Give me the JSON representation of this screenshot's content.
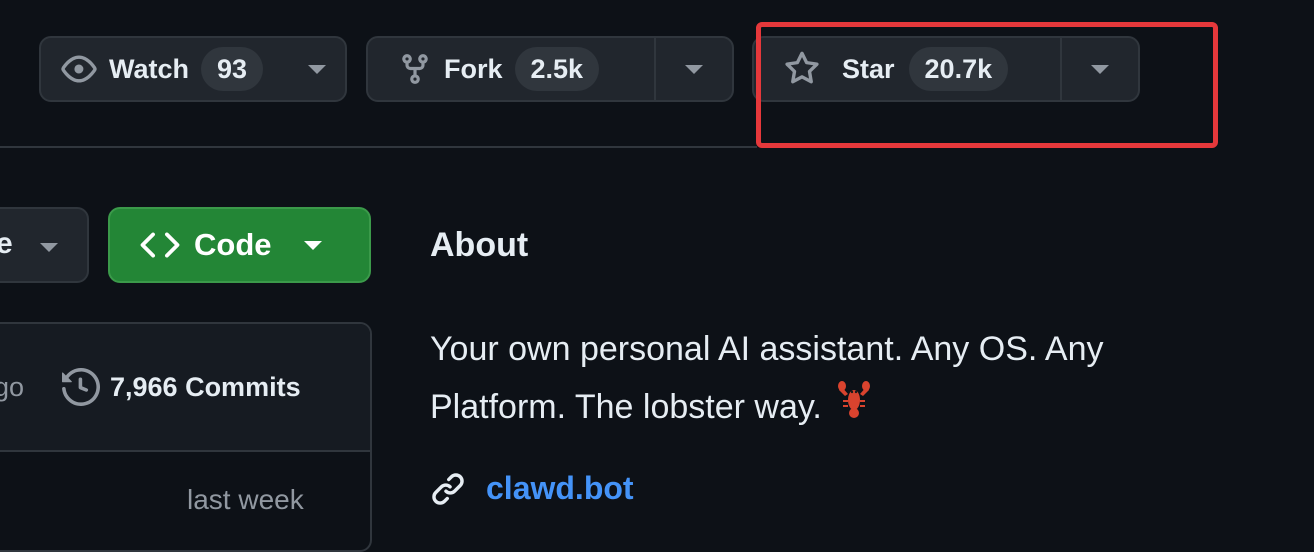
{
  "header": {
    "watch": {
      "label": "Watch",
      "count": "93"
    },
    "fork": {
      "label": "Fork",
      "count": "2.5k"
    },
    "star": {
      "label": "Star",
      "count": "20.7k"
    }
  },
  "toolbar": {
    "branch_label_fragment": "e",
    "code_label": "Code"
  },
  "commits_panel": {
    "time_fragment": "go",
    "commits_label": "7,966 Commits",
    "row_time": "last week"
  },
  "about": {
    "title": "About",
    "description": "Your own personal AI assistant. Any OS. Any Platform. The lobster way.",
    "website": "clawd.bot"
  },
  "colors": {
    "background": "#0d1117",
    "button_bg": "#21262d",
    "border": "#30363d",
    "code_green": "#238636",
    "link_blue": "#4493f8",
    "highlight_red": "#e5383b"
  },
  "icons": [
    "eye-icon",
    "fork-icon",
    "star-icon",
    "code-icon",
    "history-icon",
    "link-icon",
    "lobster-emoji"
  ]
}
